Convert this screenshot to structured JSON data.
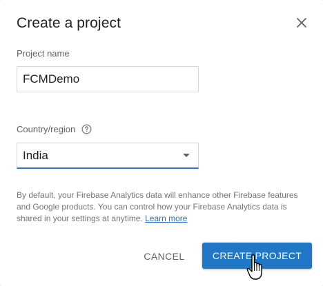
{
  "dialog": {
    "title": "Create a project"
  },
  "project_name": {
    "label": "Project name",
    "value": "FCMDemo"
  },
  "country": {
    "label": "Country/region",
    "selected": "India"
  },
  "info": {
    "text": "By default, your Firebase Analytics data will enhance other Firebase features and Google products. You can control how your Firebase Analytics data is shared in your settings at anytime.",
    "link": "Learn more"
  },
  "actions": {
    "cancel": "CANCEL",
    "create": "CREATE PROJECT"
  },
  "colors": {
    "primary": "#1f77c6",
    "focus_underline": "#2979c9",
    "link": "#1e6ec6"
  },
  "icons": {
    "close": "close-icon",
    "help": "help-icon",
    "dropdown": "caret-down-icon",
    "cursor": "hand-pointer-icon"
  }
}
